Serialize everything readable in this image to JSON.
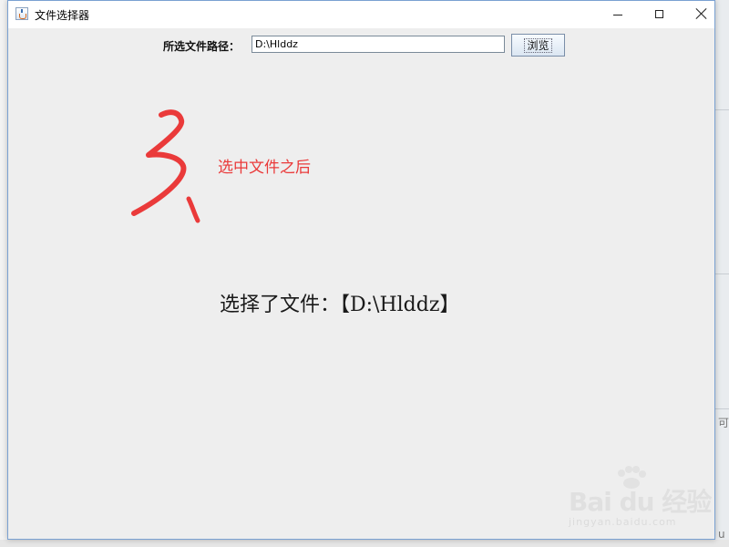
{
  "window": {
    "title": "文件选择器",
    "controls": {
      "minimize_icon": "minimize-icon",
      "maximize_icon": "maximize-icon",
      "close_icon": "close-icon"
    }
  },
  "form": {
    "path_label": "所选文件路径：",
    "path_value": "D:\\Hlddz",
    "browse_label": "浏览"
  },
  "annotation": {
    "number_glyph": "3",
    "text": "选中文件之后",
    "color": "#ea3a3a"
  },
  "result": {
    "text": "选择了文件：【D:\\Hlddz】"
  },
  "watermark": {
    "main": "Bai du 经验",
    "sub": "jingyan.baidu.com"
  },
  "background": {
    "right_text_1": "可",
    "right_text_2": "u"
  }
}
